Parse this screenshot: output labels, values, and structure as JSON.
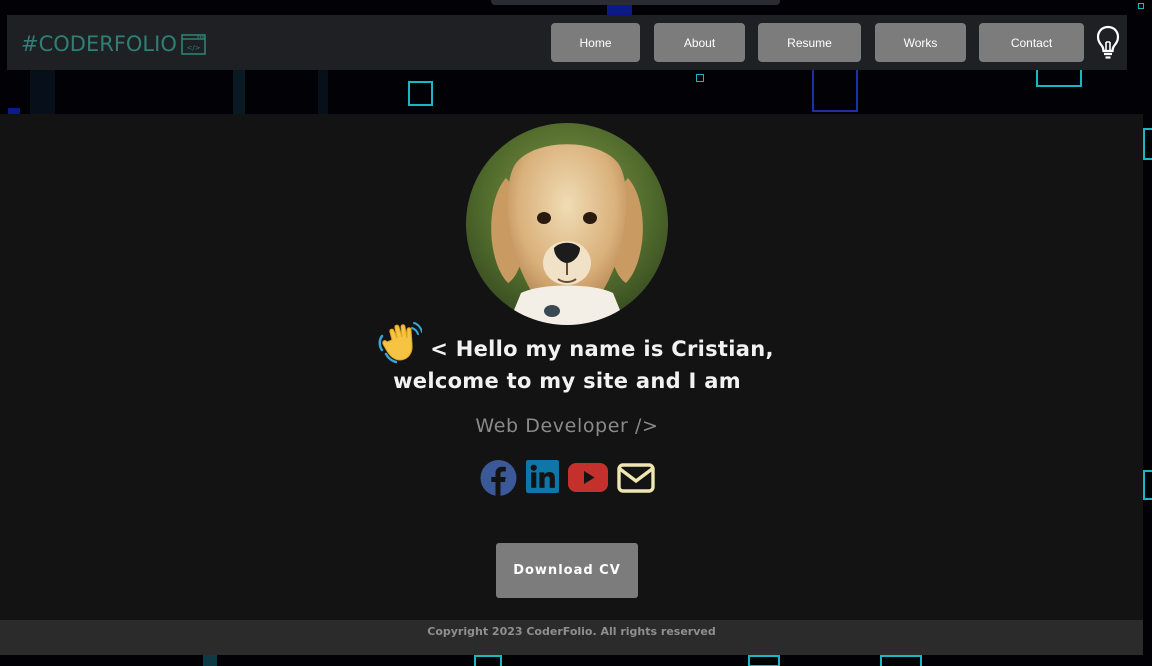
{
  "brand": {
    "logo_text": "#CODERFOLIO",
    "logo_icon": "code-window-icon",
    "logo_color": "#2f7f74"
  },
  "nav": {
    "items": [
      {
        "label": "Home"
      },
      {
        "label": "About"
      },
      {
        "label": "Resume"
      },
      {
        "label": "Works"
      },
      {
        "label": "Contact"
      }
    ],
    "theme_toggle_icon": "lightbulb-icon",
    "button_color": "#7c7c7c"
  },
  "hero": {
    "avatar_alt": "golden retriever puppy avatar",
    "greeting_line1": "< Hello my name is Cristian,",
    "greeting_line2": "welcome to my site and I am",
    "role": "Web Developer />",
    "wave_icon": "waving-hand-icon",
    "socials": [
      {
        "name": "facebook-icon",
        "color": "#3b5998"
      },
      {
        "name": "linkedin-icon",
        "color": "#0e76a8"
      },
      {
        "name": "youtube-icon",
        "color": "#c4302b"
      },
      {
        "name": "email-icon",
        "color": "#efe6b0"
      }
    ],
    "cv_button": "Download CV"
  },
  "footer": {
    "copyright": "Copyright 2023 CoderFolio. All rights reserved"
  }
}
